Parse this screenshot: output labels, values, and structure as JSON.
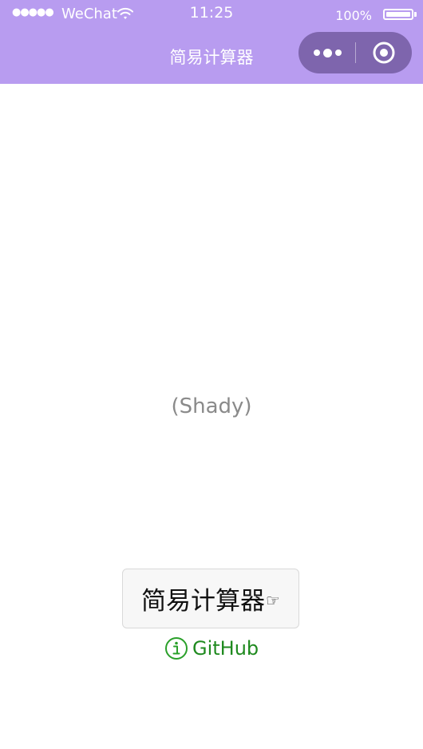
{
  "status_bar": {
    "signal": "●●●●●",
    "carrier": "WeChat",
    "time": "11:25",
    "battery_percent": "100%"
  },
  "nav": {
    "title": "简易计算器",
    "background_color": "#b89cf0",
    "capsule_color": "#7e65ad"
  },
  "content": {
    "author_label": "(Shady)",
    "main_button": {
      "label": "简易计算器",
      "icon": "☞"
    },
    "github_link": {
      "label": "GitHub",
      "icon": "info-icon",
      "color": "#1f8a1f"
    }
  }
}
